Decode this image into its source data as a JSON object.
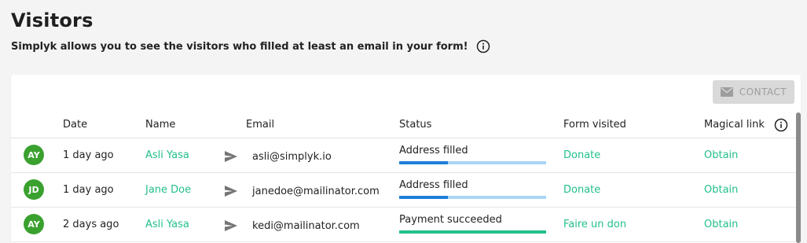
{
  "page": {
    "title": "Visitors",
    "subtitle": "Simplyk allows you to see the visitors who filled at least an email in your form!"
  },
  "toolbar": {
    "contact_label": "CONTACT"
  },
  "table": {
    "headers": {
      "date": "Date",
      "name": "Name",
      "email": "Email",
      "status": "Status",
      "form": "Form visited",
      "magic": "Magical link"
    },
    "rows": [
      {
        "initials": "AY",
        "date": "1 day ago",
        "name": "Asli Yasa",
        "email": "asli@simplyk.io",
        "status": "Address filled",
        "progress": 0.33,
        "progress_color": "#1d7fd8",
        "form": "Donate",
        "magic": "Obtain"
      },
      {
        "initials": "JD",
        "date": "1 day ago",
        "name": "Jane Doe",
        "email": "janedoe@mailinator.com",
        "status": "Address filled",
        "progress": 0.33,
        "progress_color": "#1d7fd8",
        "form": "Donate",
        "magic": "Obtain"
      },
      {
        "initials": "AY",
        "date": "2 days ago",
        "name": "Asli Yasa",
        "email": "kedi@mailinator.com",
        "status": "Payment succeeded",
        "progress": 1.0,
        "progress_color": "#22c08a",
        "form": "Faire un don",
        "magic": "Obtain"
      }
    ]
  },
  "colors": {
    "accent_green": "#22c08a",
    "avatar_green": "#3aa12f",
    "progress_blue": "#1d7fd8",
    "progress_track": "#a9d5f5"
  },
  "icons": {
    "subtitle_info": "info-icon",
    "contact": "mail-icon",
    "magic_info": "info-icon",
    "row_action": "send-icon"
  }
}
